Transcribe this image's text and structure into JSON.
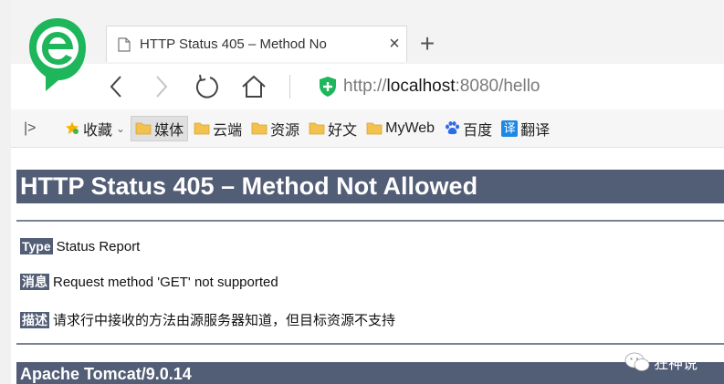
{
  "browser": {
    "tab_title": "HTTP Status 405 – Method No",
    "tab_close": "×",
    "new_tab": "+",
    "url_scheme": "http://",
    "url_host": "localhost",
    "url_rest": ":8080/hello",
    "accent_color": "#1db65b"
  },
  "bookmarks": {
    "toggle": "|>",
    "items": [
      {
        "label": "收藏",
        "icon": "star-icon"
      },
      {
        "label": "媒体",
        "icon": "folder-icon"
      },
      {
        "label": "云端",
        "icon": "folder-icon"
      },
      {
        "label": "资源",
        "icon": "folder-icon"
      },
      {
        "label": "好文",
        "icon": "folder-icon"
      },
      {
        "label": "MyWeb",
        "icon": "folder-icon"
      },
      {
        "label": "百度",
        "icon": "baidu-paw-icon"
      },
      {
        "label": "翻译",
        "icon": "translate-icon",
        "icon_text": "译"
      }
    ],
    "chevron": "⌄"
  },
  "page": {
    "title": "HTTP Status 405 – Method Not Allowed",
    "type_label": "Type",
    "type_value": "Status Report",
    "message_label": "消息",
    "message_value": "Request method 'GET' not supported",
    "description_label": "描述",
    "description_value": "请求行中接收的方法由源服务器知道，但目标资源不支持",
    "footer": "Apache Tomcat/9.0.14",
    "header_color": "#525d76"
  },
  "watermark": {
    "text": "狂神说"
  }
}
